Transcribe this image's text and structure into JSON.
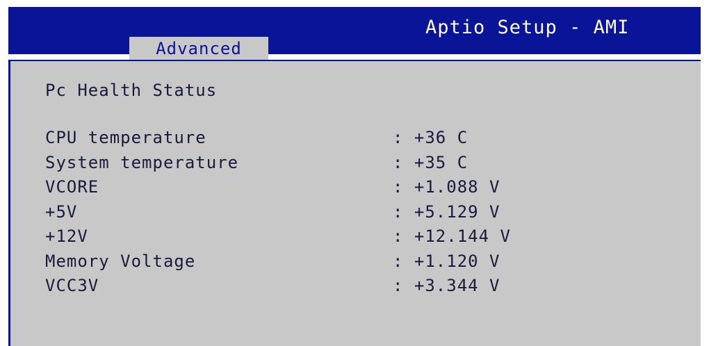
{
  "header": {
    "title": "Aptio Setup - AMI",
    "active_tab": "Advanced"
  },
  "main": {
    "section_title": "Pc Health Status",
    "readings": [
      {
        "label": "CPU temperature",
        "value": ": +36 C"
      },
      {
        "label": "System temperature",
        "value": ": +35 C"
      },
      {
        "label": "VCORE",
        "value": ": +1.088 V"
      },
      {
        "label": "+5V",
        "value": ": +5.129 V"
      },
      {
        "label": "+12V",
        "value": ": +12.144 V"
      },
      {
        "label": "Memory Voltage",
        "value": ": +1.120 V"
      },
      {
        "label": "VCC3V",
        "value": ": +3.344 V"
      }
    ]
  },
  "colors": {
    "header_bg": "#0a1496",
    "panel_bg": "#c8c8c8",
    "text": "#1a1a3a"
  }
}
